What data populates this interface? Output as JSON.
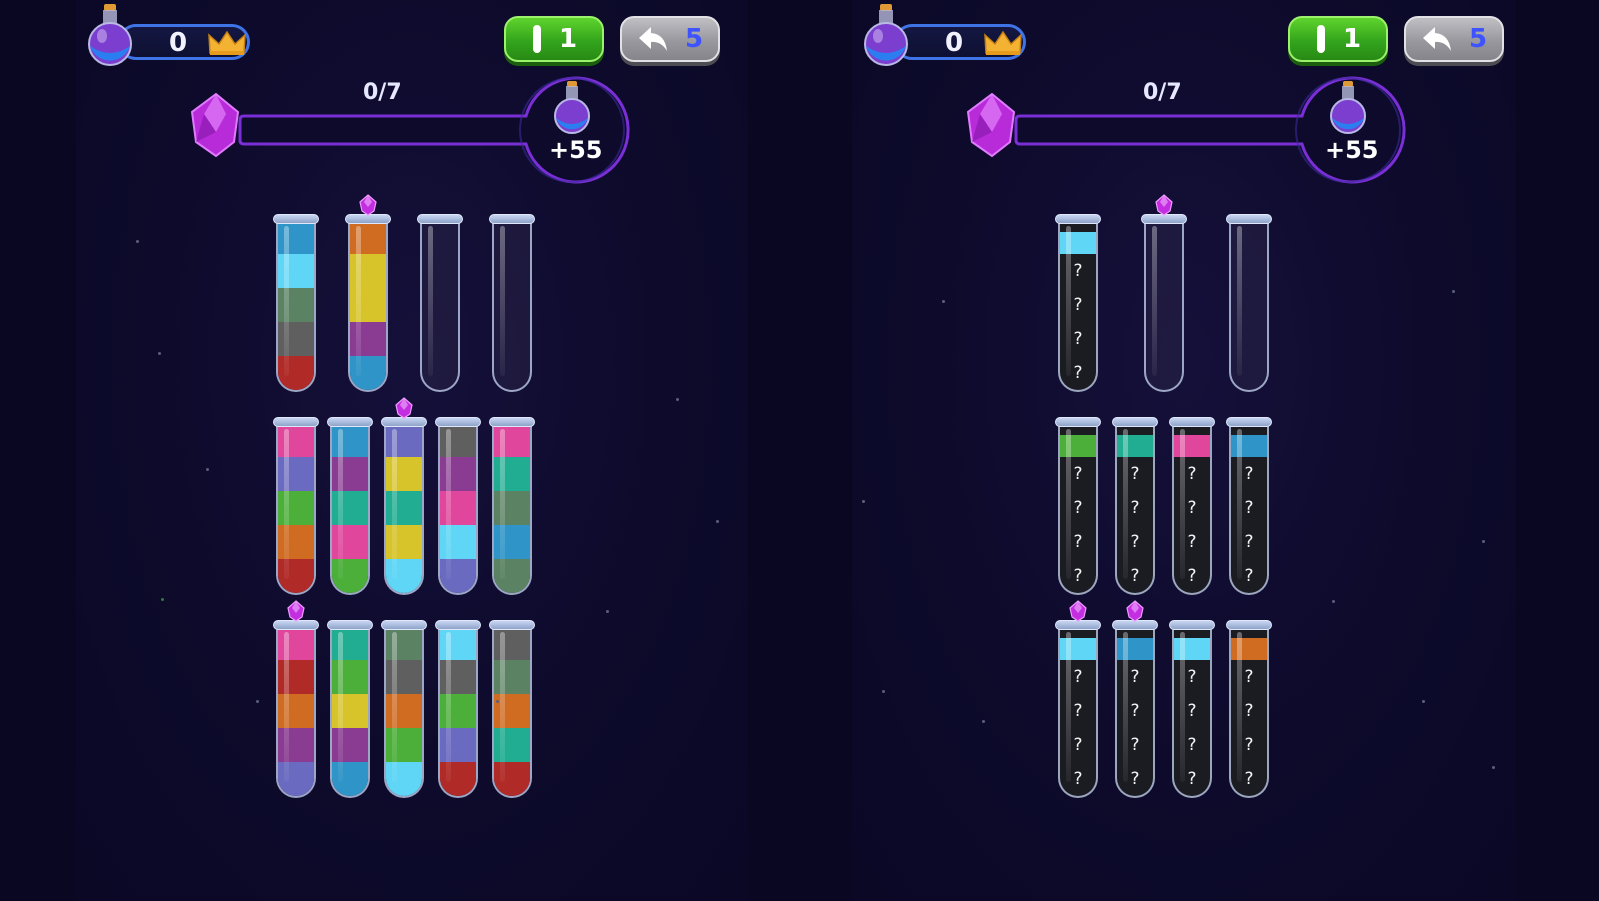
{
  "colors": {
    "red": "#b02a27",
    "green": "#4caf3a",
    "darkgreen": "#5b8263",
    "grey": "#5f5f5f",
    "lightblue": "#5fd6f5",
    "blue": "#2f94c7",
    "orange": "#d06b22",
    "yellow": "#d7c32a",
    "purple": "#8a3c93",
    "pink": "#e0479c",
    "teal": "#21ad92",
    "periwinkle": "#6a6ac1"
  },
  "panels": [
    {
      "hud": {
        "coins": "0",
        "level_button_value": "1",
        "undo_button_value": "5",
        "progress": "0/7",
        "reward": "+55"
      },
      "rows": [
        [
          {
            "layers": [
              "red",
              "grey",
              "darkgreen",
              "lightblue",
              "blue"
            ],
            "gem": false
          },
          {
            "layers": [
              "blue",
              "purple",
              "yellow",
              "yellow",
              "orange"
            ],
            "gem": true
          },
          {
            "layers": [],
            "gem": false
          },
          {
            "layers": [],
            "gem": false
          }
        ],
        [
          {
            "layers": [
              "red",
              "orange",
              "green",
              "periwinkle",
              "pink"
            ],
            "gem": false
          },
          {
            "layers": [
              "green",
              "pink",
              "teal",
              "purple",
              "blue"
            ],
            "gem": false
          },
          {
            "layers": [
              "lightblue",
              "yellow",
              "teal",
              "yellow",
              "periwinkle"
            ],
            "gem": true
          },
          {
            "layers": [
              "periwinkle",
              "lightblue",
              "pink",
              "purple",
              "grey"
            ],
            "gem": false
          },
          {
            "layers": [
              "darkgreen",
              "blue",
              "darkgreen",
              "teal",
              "pink"
            ],
            "gem": false
          }
        ],
        [
          {
            "layers": [
              "periwinkle",
              "purple",
              "orange",
              "red",
              "pink"
            ],
            "gem": true
          },
          {
            "layers": [
              "blue",
              "purple",
              "yellow",
              "green",
              "teal"
            ],
            "gem": false
          },
          {
            "layers": [
              "lightblue",
              "green",
              "orange",
              "grey",
              "darkgreen"
            ],
            "gem": false
          },
          {
            "layers": [
              "red",
              "periwinkle",
              "green",
              "grey",
              "lightblue"
            ],
            "gem": false
          },
          {
            "layers": [
              "red",
              "teal",
              "orange",
              "darkgreen",
              "grey"
            ],
            "gem": false
          }
        ]
      ]
    },
    {
      "hud": {
        "coins": "0",
        "level_button_value": "1",
        "undo_button_value": "5",
        "progress": "0/7",
        "reward": "+55"
      },
      "hidden_symbol": "?",
      "rows": [
        [
          {
            "top": "lightblue",
            "hidden": 4,
            "gem": false
          },
          {
            "top": null,
            "hidden": 0,
            "gem": true
          },
          {
            "top": null,
            "hidden": 0,
            "gem": false
          }
        ],
        [
          {
            "top": "green",
            "hidden": 4,
            "gem": false
          },
          {
            "top": "teal",
            "hidden": 4,
            "gem": false
          },
          {
            "top": "pink",
            "hidden": 4,
            "gem": false
          },
          {
            "top": "blue",
            "hidden": 4,
            "gem": false
          }
        ],
        [
          {
            "top": "lightblue",
            "hidden": 4,
            "gem": true
          },
          {
            "top": "blue",
            "hidden": 4,
            "gem": true
          },
          {
            "top": "lightblue",
            "hidden": 4,
            "gem": false
          },
          {
            "top": "orange",
            "hidden": 4,
            "gem": false
          }
        ]
      ]
    }
  ]
}
